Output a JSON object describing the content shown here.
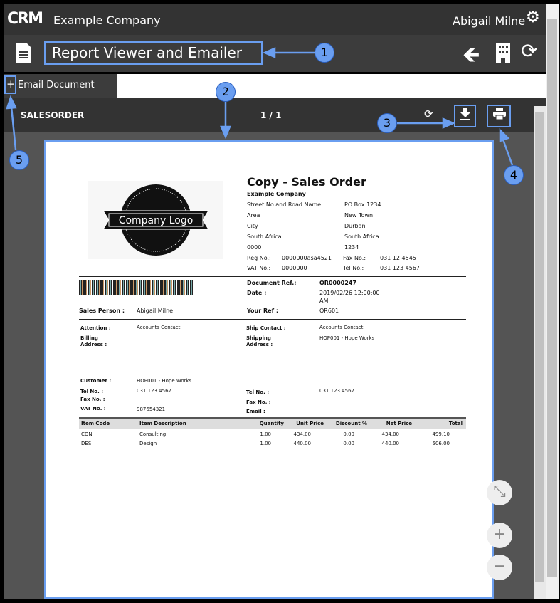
{
  "header": {
    "logo": "CRM",
    "company": "Example Company",
    "user": "Abigail Milne"
  },
  "titlebar": {
    "title": "Report Viewer and Emailer"
  },
  "tabs": {
    "email": "Email Document",
    "plus": "+"
  },
  "viewer": {
    "report_name": "SALESORDER",
    "page_indicator": "1 / 1"
  },
  "zoom": {
    "fit": "⤡",
    "in": "+",
    "out": "−"
  },
  "annotations": [
    "1",
    "2",
    "3",
    "4",
    "5"
  ],
  "doc": {
    "logo_text": "Company Logo",
    "title": "Copy - Sales Order",
    "company": "Example Company",
    "addr_left": [
      "Street No and Road Name",
      "Area",
      "City",
      "South Africa",
      "0000"
    ],
    "addr_right": [
      "PO Box 1234",
      "New Town",
      "Durban",
      "South Africa",
      "1234"
    ],
    "reg_label": "Reg No.:",
    "reg": "0000000asa4521",
    "fax_label": "Fax No.:",
    "fax": "031 12 4545",
    "vat_label": "VAT No.:",
    "vat": "0000000",
    "tel_label": "Tel No.:",
    "tel": "031 123 4567",
    "docref_label": "Document Ref.:",
    "docref": "OR0000247",
    "date_label": "Date :",
    "date": "2019/02/26 12:00:00",
    "date2": "AM",
    "sales_label": "Sales Person :",
    "sales": "Abigail Milne",
    "yourref_label": "Your Ref :",
    "yourref": "OR601",
    "attention_label": "Attention :",
    "attention": "Accounts Contact",
    "billing_label1": "Billing",
    "billing_label2": "Address :",
    "shipcontact_label": "Ship Contact :",
    "shipcontact": "Accounts Contact",
    "shipping_label1": "Shipping",
    "shipping_label2": "Address :",
    "shipping": "HOP001 - Hope Works",
    "customer_label": "Customer :",
    "customer": "HOP001 - Hope Works",
    "ctel_label": "Tel No. :",
    "ctel": "031 123 4567",
    "cfax_label": "Fax No. :",
    "cvat_label": "VAT No. :",
    "cvat": "987654321",
    "stel_label": "Tel No. :",
    "stel": "031 123 4567",
    "sfax_label": "Fax No. :",
    "semail_label": "Email :",
    "columns": [
      "Item Code",
      "Item Description",
      "Quantity",
      "Unit Price",
      "Discount %",
      "Net Price",
      "Total"
    ],
    "rows": [
      [
        "CON",
        "Consulting",
        "1.00",
        "434.00",
        "0.00",
        "434.00",
        "499.10"
      ],
      [
        "DES",
        "Design",
        "1.00",
        "440.00",
        "0.00",
        "440.00",
        "506.00"
      ]
    ]
  }
}
